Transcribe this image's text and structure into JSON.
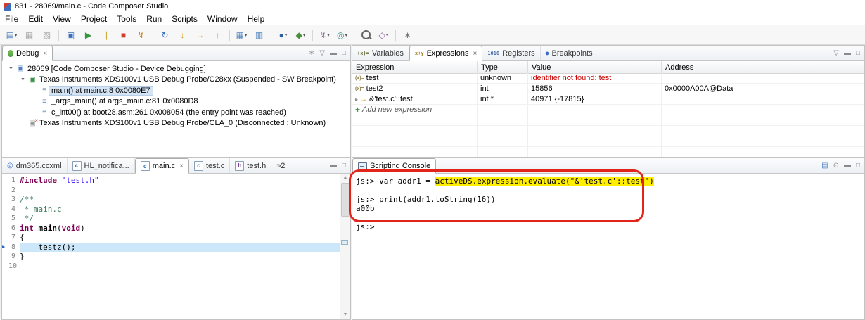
{
  "window": {
    "title": "831 - 28069/main.c - Code Composer Studio"
  },
  "menubar": {
    "items": [
      "File",
      "Edit",
      "View",
      "Project",
      "Tools",
      "Run",
      "Scripts",
      "Window",
      "Help"
    ]
  },
  "toolbar": {
    "groups": [
      [
        {
          "name": "new-wizard",
          "glyph": "▤",
          "color": "#4f81bd",
          "dd": true
        },
        {
          "name": "save",
          "glyph": "▦",
          "color": "#aaaaaa"
        },
        {
          "name": "save-all",
          "glyph": "▧",
          "color": "#aaaaaa"
        }
      ],
      [
        {
          "name": "debug-console",
          "glyph": "▣",
          "color": "#3a6fbf"
        },
        {
          "name": "run",
          "glyph": "▶",
          "color": "#36973a"
        },
        {
          "name": "suspend",
          "glyph": "∥",
          "color": "#c9a227"
        },
        {
          "name": "terminate",
          "glyph": "■",
          "color": "#d23b2e"
        },
        {
          "name": "connect-target",
          "glyph": "↯",
          "color": "#c77f1a"
        }
      ],
      [
        {
          "name": "restart",
          "glyph": "↻",
          "color": "#3a6fbf"
        },
        {
          "name": "step-into",
          "glyph": "↓",
          "color": "#d9a21b"
        },
        {
          "name": "step-over",
          "glyph": "→",
          "color": "#d9a21b"
        },
        {
          "name": "step-return",
          "glyph": "↑",
          "color": "#d9a21b"
        }
      ],
      [
        {
          "name": "memory-browser",
          "glyph": "▦",
          "color": "#4f81bd",
          "dd": true
        },
        {
          "name": "registers-view",
          "glyph": "▥",
          "color": "#4f81bd"
        }
      ],
      [
        {
          "name": "new-breakpoint",
          "glyph": "●",
          "color": "#2f5fa8",
          "dd": true
        },
        {
          "name": "debug-launch",
          "glyph": "◆",
          "color": "#4a8f3c",
          "dd": true
        }
      ],
      [
        {
          "name": "flash",
          "glyph": "↯",
          "color": "#8a5fa0",
          "dd": true
        },
        {
          "name": "profile",
          "glyph": "◎",
          "color": "#3a8f8f",
          "dd": true
        }
      ],
      [
        {
          "name": "search",
          "css": "search"
        },
        {
          "name": "external-tools",
          "glyph": "◇",
          "color": "#8a5fa0",
          "dd": true
        }
      ],
      [
        {
          "name": "open-element",
          "glyph": "∗",
          "color": "#777777"
        }
      ]
    ]
  },
  "debug_panel": {
    "tab_label": "Debug",
    "tree": [
      {
        "label": "28069 [Code Composer Studio - Device Debugging]",
        "indent": 0,
        "icon": "debug-session",
        "expander": true
      },
      {
        "label": "Texas Instruments XDS100v1 USB Debug Probe/C28xx (Suspended - SW Breakpoint)",
        "indent": 1,
        "icon": "core",
        "expander": true
      },
      {
        "label": "main() at main.c:8 0x0080E7",
        "indent": 2,
        "icon": "stack-frame",
        "selected": true
      },
      {
        "label": "_args_main() at args_main.c:81 0x0080D8",
        "indent": 2,
        "icon": "stack-frame"
      },
      {
        "label": "c_int00() at boot28.asm:261 0x008054  (the entry point was reached)",
        "indent": 2,
        "icon": "stack-frame"
      },
      {
        "label": "Texas Instruments XDS100v1 USB Debug Probe/CLA_0 (Disconnected : Unknown)",
        "indent": 1,
        "icon": "core-disconnected"
      }
    ]
  },
  "expressions_panel": {
    "tabs": [
      {
        "label": "Variables"
      },
      {
        "label": "Expressions",
        "active": true
      },
      {
        "label": "Registers"
      },
      {
        "label": "Breakpoints"
      }
    ],
    "columns": [
      "Expression",
      "Type",
      "Value",
      "Address"
    ],
    "rows": [
      {
        "icons": [
          "watch"
        ],
        "expression": "test",
        "type": "unknown",
        "value": "identifier not found: test",
        "address": "",
        "error": true
      },
      {
        "icons": [
          "watch"
        ],
        "expression": "test2",
        "type": "int",
        "value": "15856",
        "address": "0x0000A00A@Data"
      },
      {
        "icons": [
          "expander",
          "pointer"
        ],
        "expression": "&'test.c'::test",
        "type": "int *",
        "value": "40971 {-17815}",
        "address": ""
      },
      {
        "icons": [
          "add"
        ],
        "expression": "Add new expression",
        "type": "",
        "value": "",
        "address": "",
        "add": true
      }
    ]
  },
  "editor_panel": {
    "tabs": [
      {
        "label": "dm365.ccxml"
      },
      {
        "label": "HL_notifica..."
      },
      {
        "label": "main.c",
        "active": true
      },
      {
        "label": "test.c"
      },
      {
        "label": "test.h"
      },
      {
        "label": "»2"
      }
    ],
    "lines": [
      {
        "no": "1",
        "segments": [
          {
            "text": "#include ",
            "style": "dir"
          },
          {
            "text": "\"test.h\"",
            "style": "str"
          }
        ]
      },
      {
        "no": "2",
        "segments": []
      },
      {
        "no": "3",
        "segments": [
          {
            "text": "/**",
            "style": "com"
          }
        ]
      },
      {
        "no": "4",
        "segments": [
          {
            "text": " * main.c",
            "style": "com"
          }
        ]
      },
      {
        "no": "5",
        "segments": [
          {
            "text": " */",
            "style": "com"
          }
        ]
      },
      {
        "no": "6",
        "segments": [
          {
            "text": "int",
            "style": "kw"
          },
          {
            "text": " ",
            "style": "pln"
          },
          {
            "text": "main",
            "style": "fn"
          },
          {
            "text": "(",
            "style": "pln"
          },
          {
            "text": "void",
            "style": "kw"
          },
          {
            "text": ")",
            "style": "pln"
          }
        ]
      },
      {
        "no": "7",
        "segments": [
          {
            "text": "{",
            "style": "pln"
          }
        ]
      },
      {
        "no": "8",
        "segments": [
          {
            "text": "    testz();",
            "style": "pln"
          }
        ],
        "current": true,
        "breakpoint": true
      },
      {
        "no": "9",
        "segments": [
          {
            "text": "}",
            "style": "pln"
          }
        ]
      },
      {
        "no": "10",
        "segments": []
      }
    ]
  },
  "console_panel": {
    "tab_label": "Scripting Console",
    "lines": [
      {
        "segments": [
          {
            "text": "js:> var addr1 = ",
            "style": "pln"
          },
          {
            "text": "activeDS.expression.evaluate(\"&'test.c'::test\")",
            "style": "hl"
          }
        ]
      },
      {
        "segments": []
      },
      {
        "segments": [
          {
            "text": "js:> print(addr1.toString(16))",
            "style": "pln"
          }
        ]
      },
      {
        "segments": [
          {
            "text": "a00b",
            "style": "pln"
          }
        ]
      },
      {
        "segments": []
      },
      {
        "segments": [
          {
            "text": "js:>",
            "style": "pln"
          }
        ]
      }
    ]
  },
  "colors": {
    "highlight": "#ffee00",
    "error_text": "#cc0000",
    "annotation": "#e1251b",
    "current_line": "#cbe7f9",
    "tree_selection": "#d4e4f4"
  }
}
